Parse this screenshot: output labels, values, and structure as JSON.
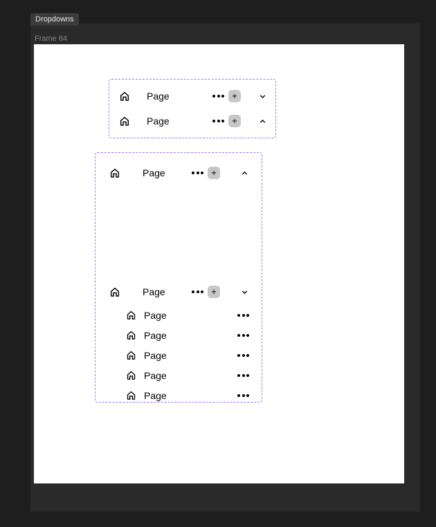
{
  "tag": "Dropdowns",
  "frame_label": "Frame 64",
  "box1": {
    "rows": [
      {
        "label": "Page",
        "expanded": false
      },
      {
        "label": "Page",
        "expanded": true
      }
    ]
  },
  "box2": {
    "top_row": {
      "label": "Page",
      "expanded": true
    },
    "section": {
      "header": {
        "label": "Page",
        "expanded": false
      },
      "items": [
        {
          "label": "Page"
        },
        {
          "label": "Page"
        },
        {
          "label": "Page"
        },
        {
          "label": "Page"
        },
        {
          "label": "Page"
        }
      ]
    }
  }
}
